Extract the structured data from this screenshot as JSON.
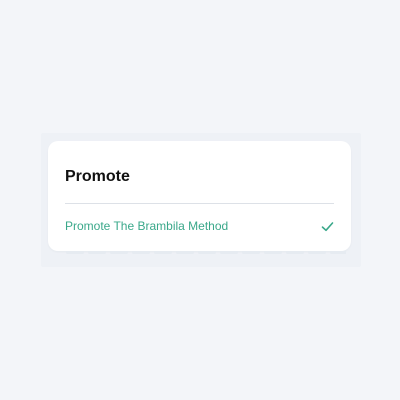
{
  "card": {
    "title": "Promote",
    "option": {
      "label": "Promote The Brambila Method",
      "selected": true,
      "icon": "check-icon"
    }
  },
  "colors": {
    "background": "#f3f5f9",
    "card": "#ffffff",
    "accent": "#3aa88a",
    "title": "#111111",
    "divider": "#dde1e7"
  }
}
